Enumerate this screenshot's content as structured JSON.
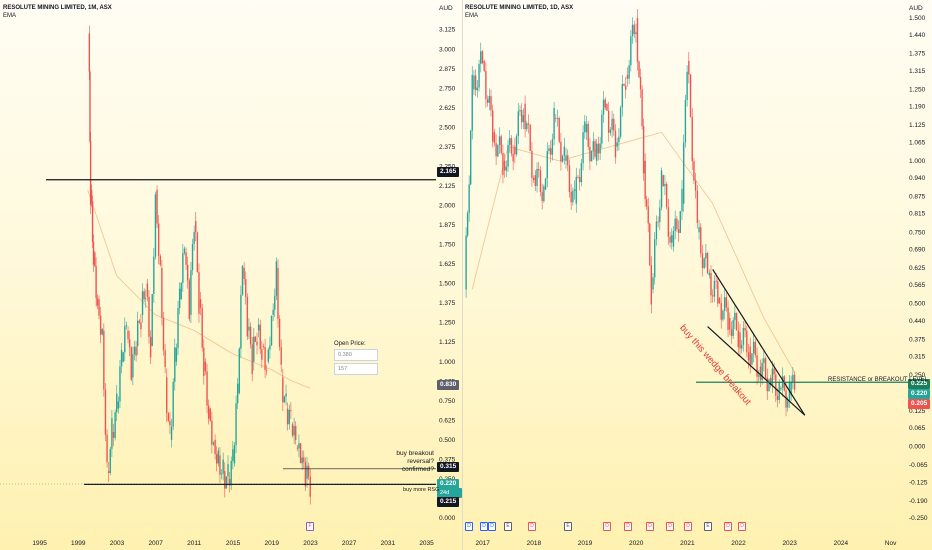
{
  "left": {
    "title": "RESOLUTE MINING LIMITED, 1M, ASX",
    "indicator": "EMA",
    "currency": "AUD",
    "y_ticks": [
      "3.125",
      "3.000",
      "2.875",
      "2.750",
      "2.625",
      "2.500",
      "2.375",
      "2.250",
      "2.125",
      "2.000",
      "1.875",
      "1.750",
      "1.625",
      "1.500",
      "1.375",
      "1.250",
      "1.125",
      "1.000",
      "0.875",
      "0.750",
      "0.625",
      "0.500",
      "0.375",
      "0.250",
      "0.125",
      "0.000"
    ],
    "x_ticks": [
      "1995",
      "1999",
      "2003",
      "2007",
      "2011",
      "2015",
      "2019",
      "2023",
      "2027",
      "2031",
      "2035"
    ],
    "price_tags": {
      "resistance": "2.165",
      "ema": "0.830",
      "breakout": "0.315",
      "last": "0.220",
      "countdown": "24d 23h",
      "support": "0.215"
    },
    "annotations": {
      "breakout_line1": "buy breakout",
      "breakout_line2": "reversal? confirmed?",
      "buy_more": "buy more RSG"
    },
    "popup": {
      "title": "Open Price:",
      "value1": "0.380",
      "value2": "157"
    },
    "event_icon": "F",
    "colors": {
      "up": "#26a69a",
      "down": "#ef5350",
      "ema": "#f0b27a"
    }
  },
  "right": {
    "title": "RESOLUTE MINING LIMITED, 1D, ASX",
    "indicator": "EMA",
    "currency": "AUD",
    "y_ticks": [
      "1.500",
      "1.440",
      "1.375",
      "1.315",
      "1.250",
      "1.190",
      "1.125",
      "1.065",
      "1.000",
      "0.940",
      "0.875",
      "0.815",
      "0.750",
      "0.690",
      "0.625",
      "0.565",
      "0.500",
      "0.440",
      "0.375",
      "0.315",
      "0.250",
      "0.190",
      "0.125",
      "0.065",
      "0.000",
      "-0.065",
      "-0.125",
      "-0.190",
      "-0.250"
    ],
    "x_ticks": [
      "2017",
      "2018",
      "2019",
      "2020",
      "2021",
      "2022",
      "2023",
      "2024",
      "Nov"
    ],
    "price_tags": {
      "resistance": "0.225",
      "last": "0.220",
      "prev": "0.205"
    },
    "annotations": {
      "wedge": "buy this wedge breakout",
      "resistance": "RESISTANCE or BREAKOUT LEVEL"
    },
    "events": [
      "D",
      "D",
      "D",
      "E",
      "D",
      "E",
      "D",
      "D",
      "D",
      "D",
      "D",
      "E",
      "D",
      "D"
    ]
  },
  "chart_data": [
    {
      "type": "candlestick",
      "title": "RESOLUTE MINING LIMITED, 1M, ASX",
      "ylabel": "AUD",
      "ylim": [
        0,
        3.2
      ],
      "x_range": [
        1993,
        2036
      ],
      "levels": {
        "resistance": 2.165,
        "support": 0.215,
        "breakout": 0.315,
        "ema": 0.83
      },
      "series": [
        {
          "name": "EMA",
          "x": [
            2000,
            2003,
            2007,
            2011,
            2015,
            2019,
            2021,
            2023
          ],
          "values": [
            2.1,
            1.55,
            1.3,
            1.2,
            1.05,
            0.95,
            0.88,
            0.83
          ]
        }
      ],
      "close": {
        "x": [
          2000.1,
          2000.3,
          2000.6,
          2001,
          2001.5,
          2002,
          2002.5,
          2003,
          2003.5,
          2004,
          2004.5,
          2005,
          2005.5,
          2006,
          2006.5,
          2007,
          2007.5,
          2008,
          2008.5,
          2009,
          2009.5,
          2010,
          2010.5,
          2011,
          2011.5,
          2012,
          2012.5,
          2013,
          2013.5,
          2014,
          2014.5,
          2015,
          2015.5,
          2016,
          2016.5,
          2017,
          2017.5,
          2018,
          2018.5,
          2019,
          2019.5,
          2020,
          2020.5,
          2021,
          2021.5,
          2022,
          2022.5,
          2023
        ],
        "values": [
          3.1,
          2.1,
          1.7,
          1.4,
          1.2,
          0.3,
          0.55,
          0.7,
          1.0,
          1.2,
          0.9,
          1.1,
          1.3,
          1.5,
          1.1,
          2.1,
          1.6,
          0.9,
          0.5,
          1.0,
          1.4,
          1.7,
          1.3,
          1.9,
          1.4,
          1.0,
          0.7,
          0.5,
          0.4,
          0.3,
          0.25,
          0.35,
          0.8,
          1.6,
          1.2,
          1.0,
          1.2,
          1.1,
          1.0,
          1.3,
          1.6,
          0.9,
          0.7,
          0.6,
          0.45,
          0.35,
          0.25,
          0.22
        ]
      }
    },
    {
      "type": "candlestick",
      "title": "RESOLUTE MINING LIMITED, 1D, ASX",
      "ylabel": "AUD",
      "ylim": [
        -0.25,
        1.5
      ],
      "x_range": [
        2016.6,
        2025.2
      ],
      "levels": {
        "resistance": 0.225
      },
      "wedge": {
        "upper": [
          [
            2021.5,
            0.62
          ],
          [
            2023.3,
            0.11
          ]
        ],
        "lower": [
          [
            2021.4,
            0.42
          ],
          [
            2023.3,
            0.11
          ]
        ]
      },
      "series": [
        {
          "name": "EMA",
          "x": [
            2016.8,
            2017.5,
            2018.5,
            2019.5,
            2020.5,
            2021.5,
            2022.5,
            2023.1
          ],
          "values": [
            0.55,
            1.05,
            1.0,
            1.05,
            1.1,
            0.85,
            0.45,
            0.26
          ]
        }
      ],
      "close": {
        "x": [
          2016.65,
          2016.8,
          2017.0,
          2017.2,
          2017.4,
          2017.6,
          2017.8,
          2018.0,
          2018.2,
          2018.4,
          2018.6,
          2018.8,
          2019.0,
          2019.2,
          2019.4,
          2019.6,
          2019.8,
          2020.0,
          2020.15,
          2020.3,
          2020.5,
          2020.7,
          2020.9,
          2021.0,
          2021.2,
          2021.4,
          2021.6,
          2021.8,
          2022.0,
          2022.2,
          2022.4,
          2022.6,
          2022.8,
          2023.0,
          2023.1
        ],
        "values": [
          0.55,
          1.25,
          1.35,
          1.1,
          1.0,
          1.05,
          1.2,
          0.95,
          0.9,
          1.15,
          1.0,
          0.85,
          1.1,
          1.0,
          1.2,
          1.05,
          1.3,
          1.5,
          1.0,
          0.55,
          0.95,
          0.7,
          0.85,
          1.35,
          0.75,
          0.6,
          0.52,
          0.45,
          0.4,
          0.35,
          0.28,
          0.24,
          0.2,
          0.18,
          0.22
        ]
      }
    }
  ]
}
